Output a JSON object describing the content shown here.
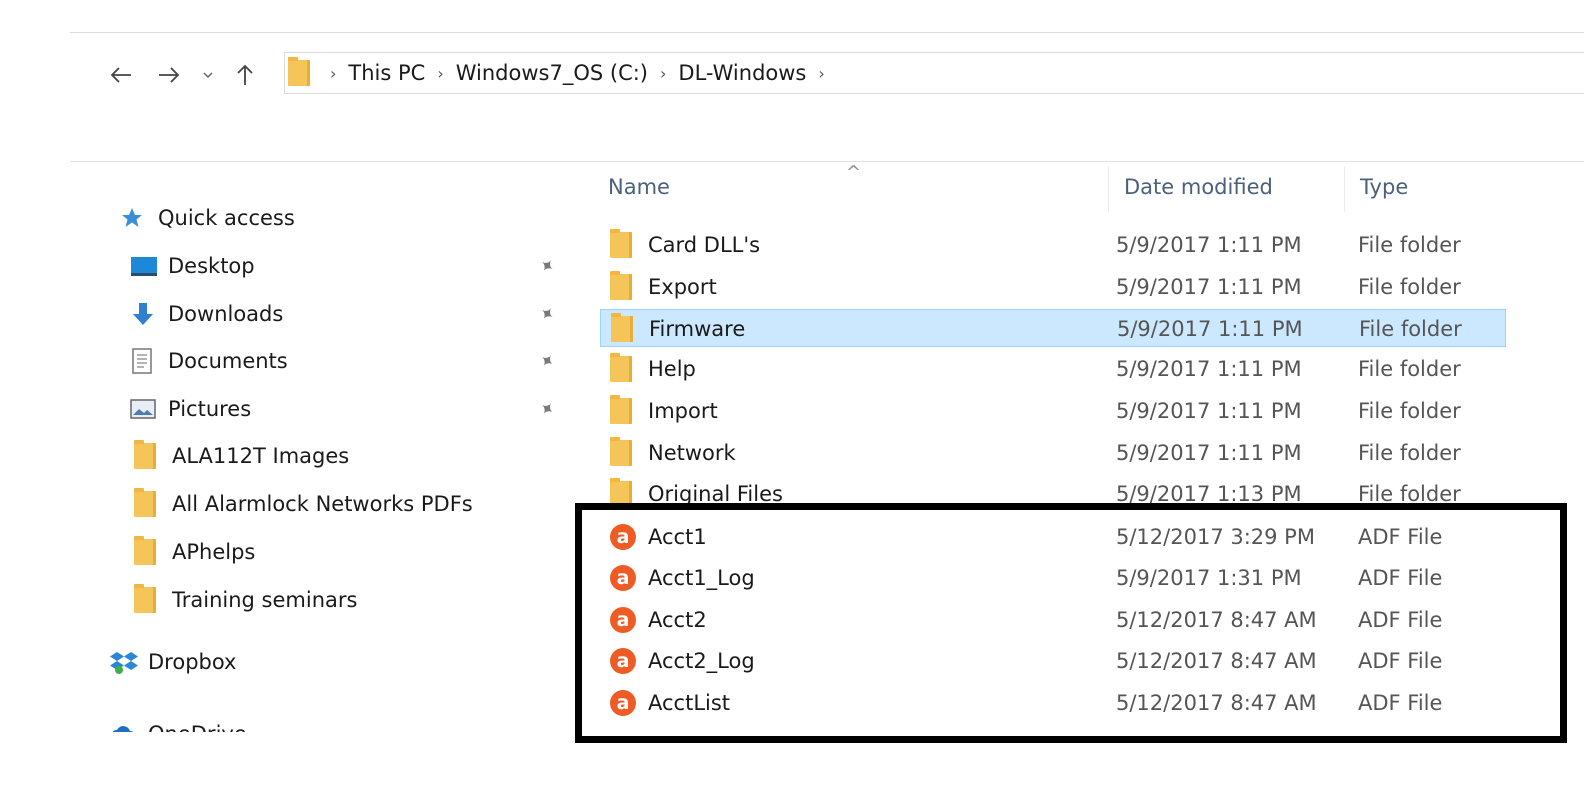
{
  "nav": {
    "back_icon": "arrow-left-icon",
    "forward_icon": "arrow-right-icon",
    "recent_icon": "chevron-down-icon",
    "up_icon": "arrow-up-icon"
  },
  "address": {
    "crumbs": [
      "This PC",
      "Windows7_OS (C:)",
      "DL-Windows"
    ],
    "separator": "›"
  },
  "sidebar": {
    "items": [
      {
        "label": "Quick access",
        "icon": "star-icon",
        "pinned": false
      },
      {
        "label": "Desktop",
        "icon": "desktop-icon",
        "pinned": true
      },
      {
        "label": "Downloads",
        "icon": "download-icon",
        "pinned": true
      },
      {
        "label": "Documents",
        "icon": "documents-icon",
        "pinned": true
      },
      {
        "label": "Pictures",
        "icon": "pictures-icon",
        "pinned": true
      },
      {
        "label": "ALA112T Images",
        "icon": "folder-icon",
        "pinned": false
      },
      {
        "label": "All Alarmlock Networks PDFs",
        "icon": "folder-icon",
        "pinned": false
      },
      {
        "label": "APhelps",
        "icon": "folder-icon",
        "pinned": false
      },
      {
        "label": "Training seminars",
        "icon": "folder-icon",
        "pinned": false
      },
      {
        "label": "Dropbox",
        "icon": "dropbox-icon",
        "pinned": false
      },
      {
        "label": "OneDrive",
        "icon": "onedrive-icon",
        "pinned": false
      }
    ]
  },
  "columns": {
    "name": "Name",
    "date": "Date modified",
    "type": "Type"
  },
  "files": [
    {
      "name": "Card DLL's",
      "date": "5/9/2017 1:11 PM",
      "type": "File folder",
      "kind": "folder"
    },
    {
      "name": "Export",
      "date": "5/9/2017 1:11 PM",
      "type": "File folder",
      "kind": "folder"
    },
    {
      "name": "Firmware",
      "date": "5/9/2017 1:11 PM",
      "type": "File folder",
      "kind": "folder",
      "selected": true
    },
    {
      "name": "Help",
      "date": "5/9/2017 1:11 PM",
      "type": "File folder",
      "kind": "folder"
    },
    {
      "name": "Import",
      "date": "5/9/2017 1:11 PM",
      "type": "File folder",
      "kind": "folder"
    },
    {
      "name": "Network",
      "date": "5/9/2017 1:11 PM",
      "type": "File folder",
      "kind": "folder"
    },
    {
      "name": "Original Files",
      "date": "5/9/2017 1:13 PM",
      "type": "File folder",
      "kind": "folder"
    },
    {
      "name": "Acct1",
      "date": "5/12/2017 3:29 PM",
      "type": "ADF File",
      "kind": "adf"
    },
    {
      "name": "Acct1_Log",
      "date": "5/9/2017 1:31 PM",
      "type": "ADF File",
      "kind": "adf"
    },
    {
      "name": "Acct2",
      "date": "5/12/2017 8:47 AM",
      "type": "ADF File",
      "kind": "adf"
    },
    {
      "name": "Acct2_Log",
      "date": "5/12/2017 8:47 AM",
      "type": "ADF File",
      "kind": "adf"
    },
    {
      "name": "AcctList",
      "date": "5/12/2017 8:47 AM",
      "type": "ADF File",
      "kind": "adf"
    }
  ],
  "adf_glyph": "a",
  "colors": {
    "selection_bg": "#cce8ff",
    "adf_icon": "#ef5b25",
    "folder": "#f6c55a",
    "header_text": "#4c607a"
  }
}
